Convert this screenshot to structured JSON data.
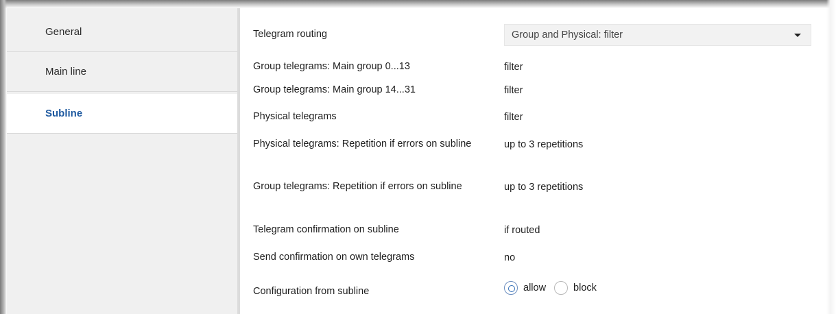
{
  "sidebar": {
    "items": [
      {
        "label": "General"
      },
      {
        "label": "Main line"
      },
      {
        "label": "Subline"
      }
    ]
  },
  "params": {
    "routing": {
      "label": "Telegram routing",
      "value": "Group and Physical: filter"
    },
    "group_0_13": {
      "label": "Group telegrams: Main group 0...13",
      "value": "filter"
    },
    "group_14_31": {
      "label": "Group telegrams: Main group 14...31",
      "value": "filter"
    },
    "physical": {
      "label": "Physical telegrams",
      "value": "filter"
    },
    "phys_repetition": {
      "label": "Physical telegrams: Repetition if errors on subline",
      "value": "up to 3 repetitions"
    },
    "group_repetition": {
      "label": "Group telegrams: Repetition if errors on subline",
      "value": "up to 3 repetitions"
    },
    "confirmation": {
      "label": "Telegram confirmation on subline",
      "value": "if routed"
    },
    "own_confirmation": {
      "label": "Send confirmation on own telegrams",
      "value": "no"
    },
    "configuration": {
      "label": "Configuration from subline",
      "options": [
        {
          "label": "allow",
          "checked": true
        },
        {
          "label": "block",
          "checked": false
        }
      ]
    }
  },
  "colors": {
    "accent": "#1f5aa0",
    "sidebar_bg": "#f0f0f0"
  },
  "icons": {
    "dropdown": "caret-down-icon"
  }
}
